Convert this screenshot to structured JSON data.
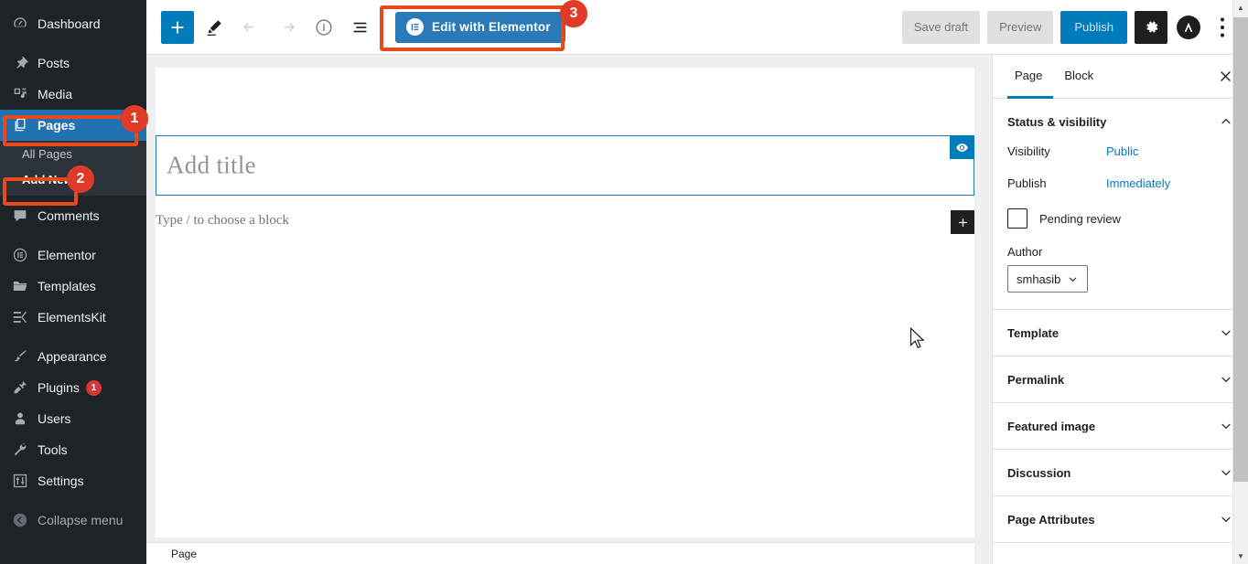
{
  "sidebar": {
    "items": [
      {
        "label": "Dashboard",
        "icon": "dashboard-icon"
      },
      {
        "label": "Posts",
        "icon": "pin-icon"
      },
      {
        "label": "Media",
        "icon": "media-icon"
      },
      {
        "label": "Pages",
        "icon": "pages-icon",
        "current": true
      },
      {
        "label": "Comments",
        "icon": "comment-icon"
      },
      {
        "label": "Elementor",
        "icon": "elementor-icon"
      },
      {
        "label": "Templates",
        "icon": "folder-icon"
      },
      {
        "label": "ElementsKit",
        "icon": "elementskit-icon"
      },
      {
        "label": "Appearance",
        "icon": "brush-icon"
      },
      {
        "label": "Plugins",
        "icon": "plug-icon",
        "badge": "1"
      },
      {
        "label": "Users",
        "icon": "user-icon"
      },
      {
        "label": "Tools",
        "icon": "wrench-icon"
      },
      {
        "label": "Settings",
        "icon": "sliders-icon"
      },
      {
        "label": "Collapse menu",
        "icon": "collapse-icon"
      }
    ],
    "submenu": [
      {
        "label": "All Pages"
      },
      {
        "label": "Add New",
        "current": true
      }
    ]
  },
  "annotations": {
    "step1": "1",
    "step2": "2",
    "step3": "3",
    "color": "#e8491d"
  },
  "toolbar": {
    "add_block_label": "+",
    "tools_tooltip": "Tools",
    "undo_tooltip": "Undo",
    "redo_tooltip": "Redo",
    "details_tooltip": "Details",
    "list_view_tooltip": "List view",
    "elementor_button": "Edit with Elementor",
    "save_draft": "Save draft",
    "preview": "Preview",
    "publish": "Publish",
    "settings_tooltip": "Settings",
    "options_tooltip": "Options"
  },
  "canvas": {
    "title_placeholder": "Add title",
    "paragraph_placeholder": "Type / to choose a block",
    "breadcrumb": "Page"
  },
  "panel": {
    "tabs": [
      {
        "label": "Page",
        "active": true
      },
      {
        "label": "Block",
        "active": false
      }
    ],
    "close_label": "Close settings",
    "status_section": {
      "title": "Status & visibility",
      "rows": [
        {
          "label": "Visibility",
          "value": "Public"
        },
        {
          "label": "Publish",
          "value": "Immediately"
        }
      ],
      "pending_review": "Pending review",
      "author_label": "Author",
      "author_value": "smhasib"
    },
    "sections": [
      {
        "title": "Template"
      },
      {
        "title": "Permalink"
      },
      {
        "title": "Featured image"
      },
      {
        "title": "Discussion"
      },
      {
        "title": "Page Attributes"
      }
    ]
  },
  "colors": {
    "wp_blue": "#2271b1",
    "gutenberg_blue": "#007cba",
    "admin_dark": "#1d2327",
    "submenu_dark": "#2c3338",
    "badge_red": "#d63638",
    "annotation_orange": "#e8491d"
  }
}
